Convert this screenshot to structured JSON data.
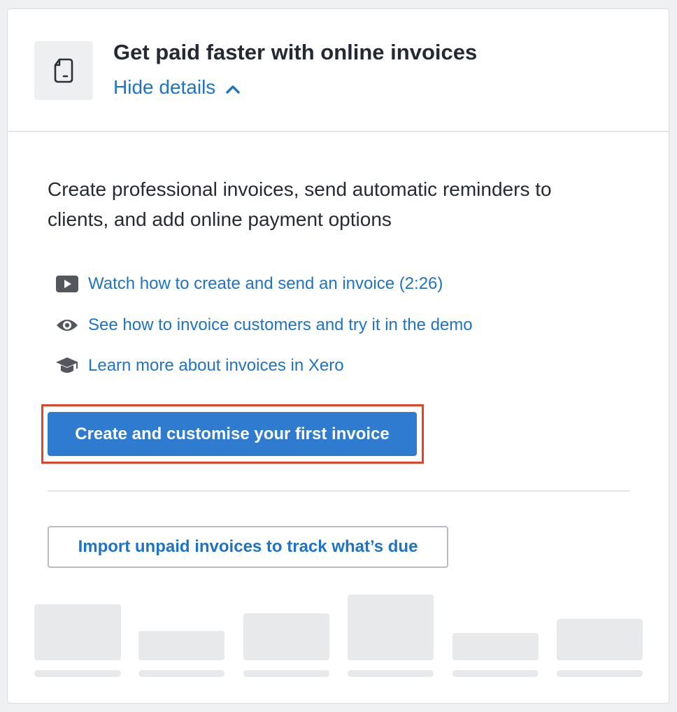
{
  "header": {
    "icon": "document-icon",
    "title": "Get paid faster with online invoices",
    "toggle_label": "Hide details",
    "toggle_icon": "chevron-up-icon"
  },
  "description": "Create professional invoices, send automatic reminders to clients, and add online payment options",
  "links": [
    {
      "icon": "video-play-icon",
      "label": "Watch how to create and send an invoice (2:26)"
    },
    {
      "icon": "eye-icon",
      "label": "See how to invoice customers and try it in the demo"
    },
    {
      "icon": "graduation-cap-icon",
      "label": "Learn more about invoices in Xero"
    }
  ],
  "primary_button": {
    "label": "Create and customise your first invoice"
  },
  "secondary_button": {
    "label": "Import unpaid invoices to track what’s due"
  },
  "colors": {
    "link": "#1e73c7",
    "primary": "#2f7bcf",
    "highlight": "#e2432a",
    "placeholder": "#e8e9eb"
  }
}
